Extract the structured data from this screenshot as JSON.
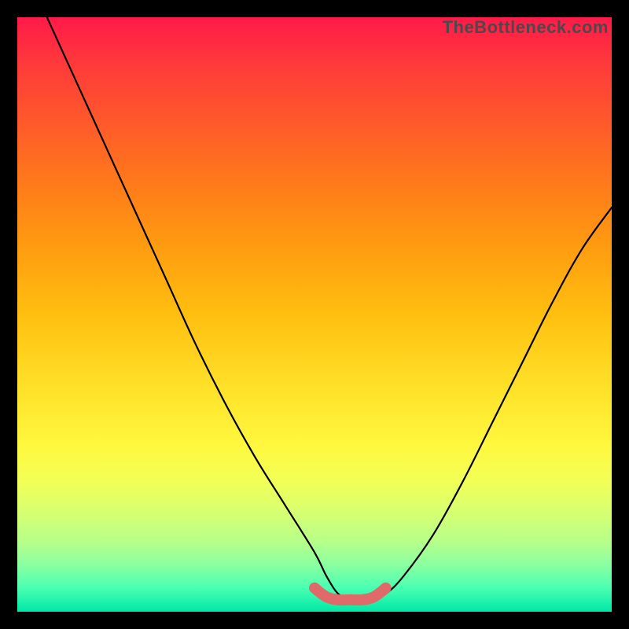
{
  "watermark": "TheBottleneck.com",
  "chart_data": {
    "type": "line",
    "title": "",
    "xlabel": "",
    "ylabel": "",
    "xlim": [
      0,
      100
    ],
    "ylim": [
      0,
      100
    ],
    "series": [
      {
        "name": "bottleneck-curve",
        "x": [
          5,
          10,
          15,
          20,
          25,
          30,
          35,
          40,
          45,
          50,
          52,
          54,
          56,
          58,
          60,
          62,
          65,
          70,
          75,
          80,
          85,
          90,
          95,
          100
        ],
        "y": [
          100,
          89,
          78,
          67,
          56,
          45,
          35,
          26,
          18,
          10,
          6,
          3,
          2,
          2,
          2,
          3,
          6,
          13,
          22,
          32,
          42,
          52,
          61,
          68
        ]
      },
      {
        "name": "optimal-band",
        "x": [
          50,
          52,
          54,
          56,
          58,
          60,
          62
        ],
        "y": [
          4,
          2.5,
          2,
          2,
          2,
          2.5,
          4
        ]
      }
    ]
  }
}
